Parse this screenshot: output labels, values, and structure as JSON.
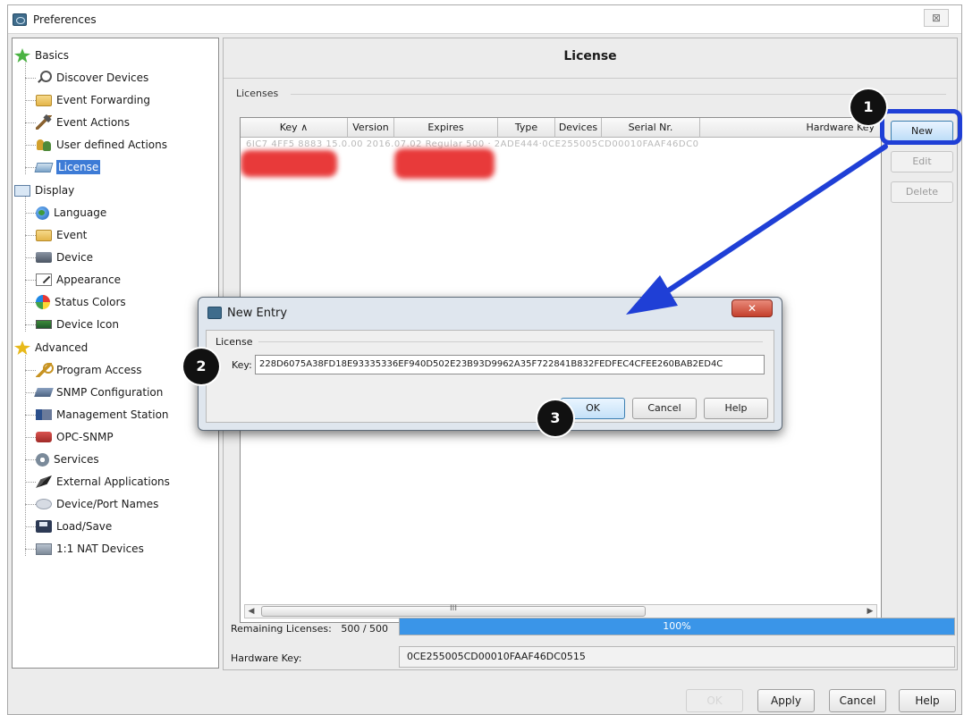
{
  "window": {
    "title": "Preferences",
    "close_glyph": "⊠"
  },
  "tree": {
    "items": [
      {
        "label": "Basics",
        "icon": "star-icon"
      },
      {
        "label": "Discover Devices",
        "icon": "magnifier-icon"
      },
      {
        "label": "Event Forwarding",
        "icon": "folder-icon"
      },
      {
        "label": "Event Actions",
        "icon": "hammer-icon"
      },
      {
        "label": "User defined Actions",
        "icon": "users-icon"
      },
      {
        "label": "License",
        "icon": "license-icon"
      },
      {
        "label": "Display",
        "icon": "display-icon"
      },
      {
        "label": "Language",
        "icon": "globe-icon"
      },
      {
        "label": "Event",
        "icon": "folder-icon"
      },
      {
        "label": "Device",
        "icon": "device-icon"
      },
      {
        "label": "Appearance",
        "icon": "appearance-icon"
      },
      {
        "label": "Status Colors",
        "icon": "status-colors-icon"
      },
      {
        "label": "Device Icon",
        "icon": "device-icon-icon"
      },
      {
        "label": "Advanced",
        "icon": "star-icon"
      },
      {
        "label": "Program Access",
        "icon": "key-icon"
      },
      {
        "label": "SNMP Configuration",
        "icon": "snmp-icon"
      },
      {
        "label": "Management Station",
        "icon": "station-icon"
      },
      {
        "label": "OPC-SNMP",
        "icon": "opc-icon"
      },
      {
        "label": "Services",
        "icon": "gear-icon"
      },
      {
        "label": "External Applications",
        "icon": "external-app-icon"
      },
      {
        "label": "Device/Port Names",
        "icon": "names-icon"
      },
      {
        "label": "Load/Save",
        "icon": "floppy-icon"
      },
      {
        "label": "1:1 NAT Devices",
        "icon": "nat-icon"
      }
    ],
    "selected": "License"
  },
  "panel": {
    "title": "License",
    "group_label": "Licenses",
    "columns": [
      "Key ∧",
      "Version",
      "Expires",
      "Type",
      "Devices",
      "Serial Nr.",
      "Hardware Key"
    ],
    "blurred_row": "6IC7 4FF5 8883      15.0.00    2016.07.02       Regular              500          ·         2ADE444·0CE255005CD00010FAAF46DC0",
    "scroll_glyph": "III",
    "buttons": {
      "new": "New",
      "edit": "Edit",
      "delete": "Delete"
    },
    "remaining_label": "Remaining Licenses:",
    "remaining_value": "500 / 500",
    "progress_text": "100%",
    "progress_fraction": 1.0,
    "hardware_key_label": "Hardware Key:",
    "hardware_key_value": "0CE255005CD00010FAAF46DC0515"
  },
  "footer": {
    "ok": "OK",
    "apply": "Apply",
    "cancel": "Cancel",
    "help": "Help"
  },
  "dialog": {
    "title": "New Entry",
    "close_glyph": "✕",
    "group_label": "License",
    "key_label": "Key:",
    "key_value": "228D6075A38FD18E93335336EF940D502E23B93D9962A35F722841B832FEDFEC4CFEE260BAB2ED4C",
    "ok": "OK",
    "cancel": "Cancel",
    "help": "Help"
  },
  "annotations": {
    "step1": "1",
    "step2": "2",
    "step3": "3",
    "color": "#1f3fd6"
  }
}
